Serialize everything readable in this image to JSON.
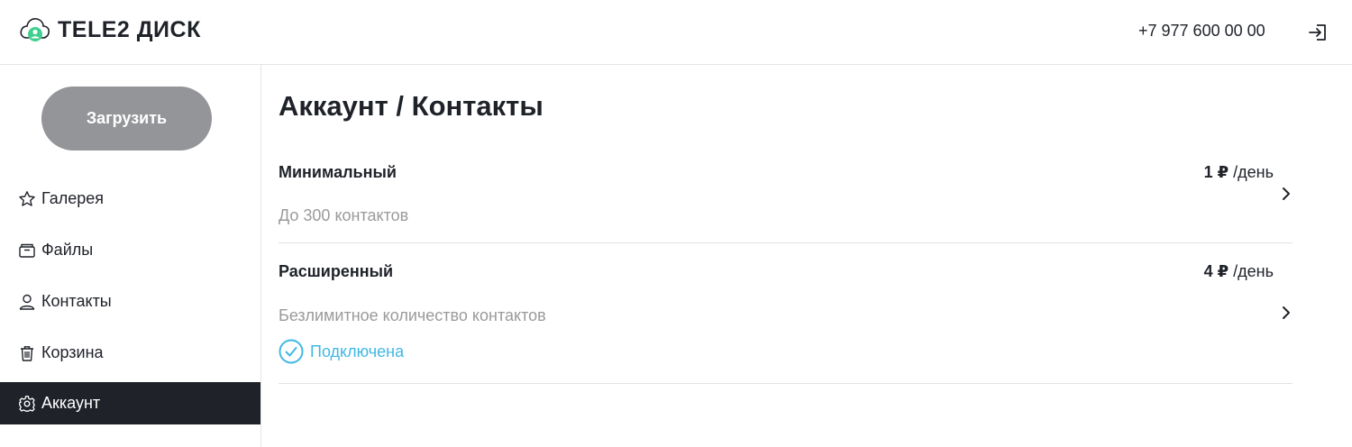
{
  "header": {
    "logo_text": "TELE2 ДИСК",
    "phone": "+7 977 600 00 00"
  },
  "sidebar": {
    "upload_label": "Загрузить",
    "items": [
      {
        "label": "Галерея",
        "icon": "star-icon"
      },
      {
        "label": "Файлы",
        "icon": "folder-icon"
      },
      {
        "label": "Контакты",
        "icon": "person-icon"
      },
      {
        "label": "Корзина",
        "icon": "trash-icon"
      },
      {
        "label": "Аккаунт",
        "icon": "gear-icon",
        "active": true
      }
    ]
  },
  "main": {
    "title": "Аккаунт / Контакты",
    "plans": [
      {
        "name": "Минимальный",
        "description": "До 300 контактов",
        "price": "1 ₽",
        "period": " /день"
      },
      {
        "name": "Расширенный",
        "description": "Безлимитное количество контактов",
        "price": "4 ₽",
        "period": " /день",
        "status": "Подключена"
      }
    ]
  },
  "colors": {
    "dark": "#1f2229",
    "upload_button": "#939598",
    "accent_status": "#3fb8e3",
    "muted_text": "#9a9a9a",
    "logo_green": "#3fcf8e"
  }
}
